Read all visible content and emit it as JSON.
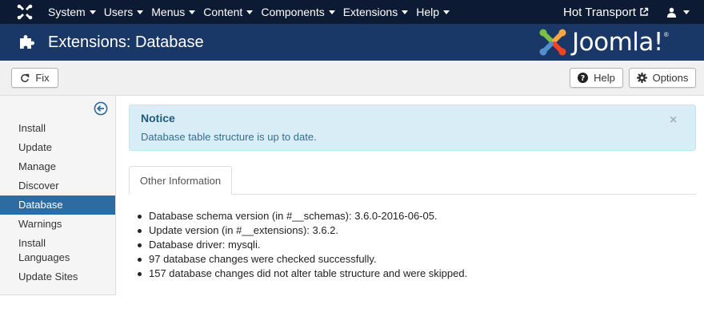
{
  "topbar": {
    "menu": [
      {
        "label": "System"
      },
      {
        "label": "Users"
      },
      {
        "label": "Menus"
      },
      {
        "label": "Content"
      },
      {
        "label": "Components"
      },
      {
        "label": "Extensions"
      },
      {
        "label": "Help"
      }
    ],
    "site_name": "Hot Transport",
    "site_icon": "external-link-icon",
    "user_icon": "user-icon"
  },
  "header": {
    "title": "Extensions: Database",
    "icon": "puzzle-icon",
    "brand": "Joomla!"
  },
  "toolbar": {
    "fix_label": "Fix",
    "help_label": "Help",
    "options_label": "Options"
  },
  "sidebar": {
    "items": [
      {
        "label": "Install"
      },
      {
        "label": "Update"
      },
      {
        "label": "Manage"
      },
      {
        "label": "Discover"
      },
      {
        "label": "Database"
      },
      {
        "label": "Warnings"
      },
      {
        "label": "Install\nLanguages"
      },
      {
        "label": "Update Sites"
      }
    ],
    "active": "Database"
  },
  "alert": {
    "heading": "Notice",
    "message": "Database table structure is up to date.",
    "close": "×"
  },
  "tabs": [
    {
      "label": "Other Information"
    }
  ],
  "info": [
    "Database schema version (in #__schemas): 3.6.0-2016-06-05.",
    "Update version (in #__extensions): 3.6.2.",
    "Database driver: mysqli.",
    "97 database changes were checked successfully.",
    "157 database changes did not alter table structure and were skipped."
  ],
  "colors": {
    "topbar": "#0d1a33",
    "header": "#1a3867",
    "active": "#2d6ca2",
    "alert_bg": "#d9edf7"
  }
}
